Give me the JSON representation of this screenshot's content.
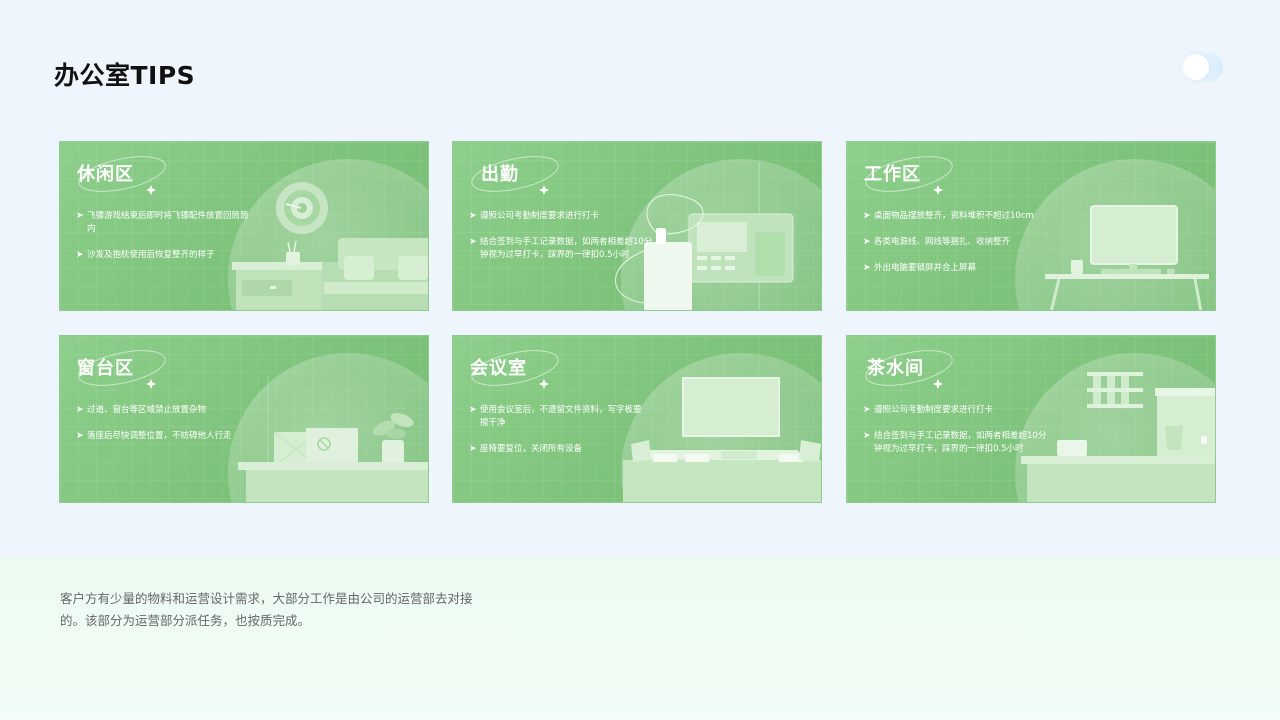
{
  "page": {
    "title": "办公室TIPS"
  },
  "cards": [
    {
      "title": "休闲区",
      "tips": [
        "飞镖游戏结束后即时将飞镖配件放置回筒筒内",
        "沙发及抱枕使用后恢复整齐的样子"
      ]
    },
    {
      "title": "出勤",
      "tips": [
        "遵照公司考勤制度要求进行打卡",
        "结合签到与手工记录数据，如两者相差超10分钟视为过早打卡，踩界的一律扣0.5小时"
      ]
    },
    {
      "title": "工作区",
      "tips": [
        "桌面物品摆放整齐，资料堆积不超过10cm",
        "各类电源线、网线等捆扎、收纳整齐",
        "外出电脑要锁屏并合上屏幕"
      ]
    },
    {
      "title": "窗台区",
      "tips": [
        "过道、窗台等区域禁止放置杂物",
        "落座后尽快调整位置，不妨碍他人行走"
      ]
    },
    {
      "title": "会议室",
      "tips": [
        "使用会议室后，不遗留文件资料，写字板要擦干净",
        "座椅要复位，关闭所有设备"
      ]
    },
    {
      "title": "茶水间",
      "tips": [
        "遵照公司考勤制度要求进行打卡",
        "结合签到与手工记录数据，如两者相差超10分钟视为过早打卡，踩界的一律扣0.5小时"
      ]
    }
  ],
  "footer": {
    "text": "客户方有少量的物料和运营设计需求，大部分工作是由公司的运营部去对接的。该部分为运营部分派任务，也按质完成。"
  },
  "icons": {
    "bullet": "chevron-right-icon",
    "sparkle": "sparkle-icon"
  },
  "colors": {
    "card_green": "#7ec37b",
    "page_bg": "#eff5fd",
    "footer_bg": "#ecfbf1"
  }
}
